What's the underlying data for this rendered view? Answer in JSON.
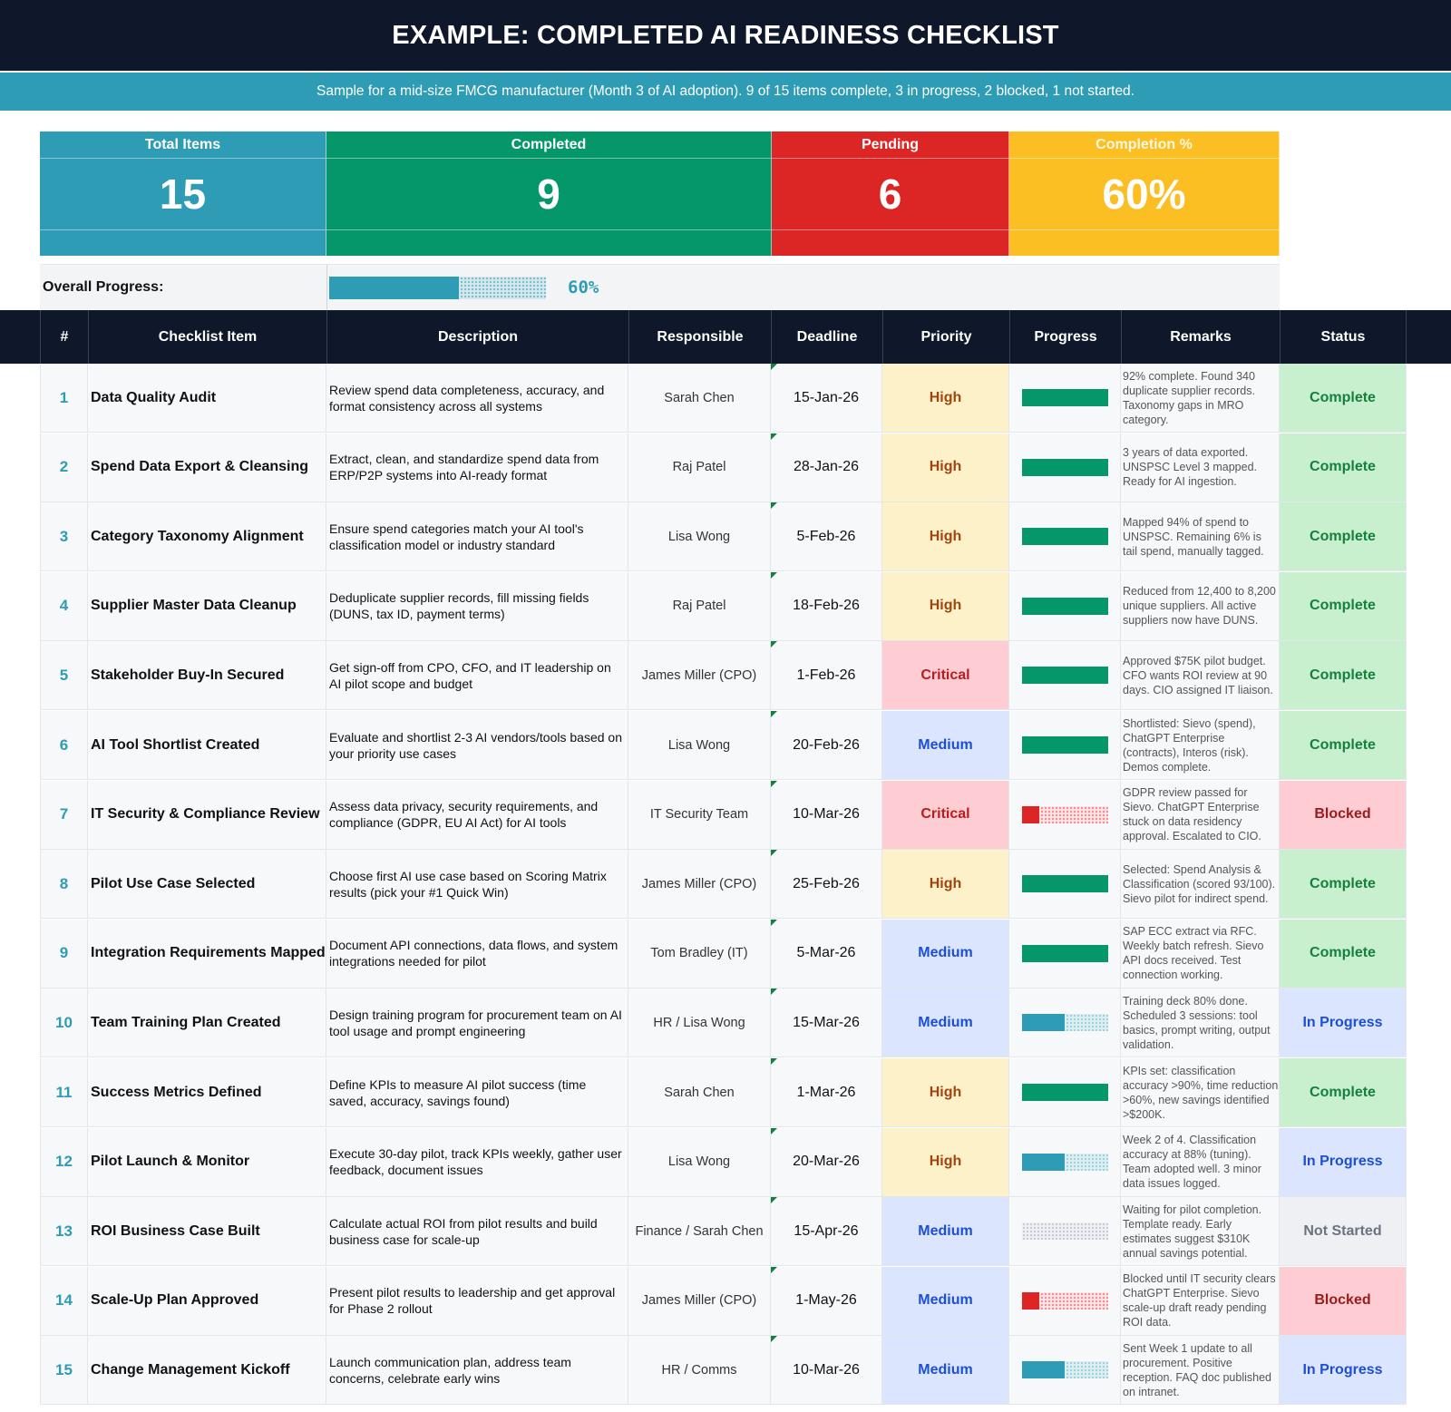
{
  "title": "EXAMPLE: COMPLETED AI READINESS CHECKLIST",
  "subtitle": "Sample for a mid-size FMCG manufacturer (Month 3 of AI adoption). 9 of 15 items complete, 3 in progress, 2 blocked, 1 not started.",
  "kpis": {
    "total": {
      "label": "Total Items",
      "value": "15"
    },
    "completed": {
      "label": "Completed",
      "value": "9"
    },
    "pending": {
      "label": "Pending",
      "value": "6"
    },
    "completion": {
      "label": "Completion %",
      "value": "60%"
    }
  },
  "overall": {
    "label": "Overall Progress:",
    "percent_text": "60%",
    "fraction": 0.6
  },
  "columns": [
    "#",
    "Checklist Item",
    "Description",
    "Responsible",
    "Deadline",
    "Priority",
    "Progress",
    "Remarks",
    "Status"
  ],
  "colors": {
    "navy": "#0f172a",
    "teal": "#2e9cb4",
    "green": "#059669",
    "red": "#dc2626",
    "amber": "#fbbf24",
    "high_bg": "#fdf1c9",
    "high_text": "#a0450f",
    "critical_bg": "#fecdd3",
    "critical_text": "#b91c1c",
    "medium_bg": "#dbe5fd",
    "medium_text": "#1d4ed8",
    "complete_bg": "#c8f0cf",
    "complete_text": "#15803d",
    "blocked_bg": "#fecdd3",
    "blocked_text": "#991b1b",
    "inprogress_bg": "#dbe5fd",
    "inprogress_text": "#1d4ed8",
    "notstarted_bg": "#eef0f3",
    "notstarted_text": "#6b7280"
  },
  "rows": [
    {
      "num": "1",
      "item": "Data Quality Audit",
      "description": "Review spend data completeness, accuracy, and format consistency across all systems",
      "responsible": "Sarah Chen",
      "deadline": "15-Jan-26",
      "priority": "High",
      "progress": 1.0,
      "progress_color": "green",
      "remarks": "92% complete. Found 340 duplicate supplier records. Taxonomy gaps in MRO category.",
      "status": "Complete"
    },
    {
      "num": "2",
      "item": "Spend Data Export & Cleansing",
      "description": "Extract, clean, and standardize spend data from ERP/P2P systems into AI-ready format",
      "responsible": "Raj Patel",
      "deadline": "28-Jan-26",
      "priority": "High",
      "progress": 1.0,
      "progress_color": "green",
      "remarks": "3 years of data exported. UNSPSC Level 3 mapped. Ready for AI ingestion.",
      "status": "Complete"
    },
    {
      "num": "3",
      "item": "Category Taxonomy Alignment",
      "description": "Ensure spend categories match your AI tool's classification model or industry standard",
      "responsible": "Lisa Wong",
      "deadline": "5-Feb-26",
      "priority": "High",
      "progress": 1.0,
      "progress_color": "green",
      "remarks": "Mapped 94% of spend to UNSPSC. Remaining 6% is tail spend, manually tagged.",
      "status": "Complete"
    },
    {
      "num": "4",
      "item": "Supplier Master Data Cleanup",
      "description": "Deduplicate supplier records, fill missing fields (DUNS, tax ID, payment terms)",
      "responsible": "Raj Patel",
      "deadline": "18-Feb-26",
      "priority": "High",
      "progress": 1.0,
      "progress_color": "green",
      "remarks": "Reduced from 12,400 to 8,200 unique suppliers. All active suppliers now have DUNS.",
      "status": "Complete"
    },
    {
      "num": "5",
      "item": "Stakeholder Buy-In Secured",
      "description": "Get sign-off from CPO, CFO, and IT leadership on AI pilot scope and budget",
      "responsible": "James Miller (CPO)",
      "deadline": "1-Feb-26",
      "priority": "Critical",
      "progress": 1.0,
      "progress_color": "green",
      "remarks": "Approved $75K pilot budget. CFO wants ROI review at 90 days. CIO assigned IT liaison.",
      "status": "Complete"
    },
    {
      "num": "6",
      "item": "AI Tool Shortlist Created",
      "description": "Evaluate and shortlist 2-3 AI vendors/tools based on your priority use cases",
      "responsible": "Lisa Wong",
      "deadline": "20-Feb-26",
      "priority": "Medium",
      "progress": 1.0,
      "progress_color": "green",
      "remarks": "Shortlisted: Sievo (spend), ChatGPT Enterprise (contracts), Interos (risk). Demos complete.",
      "status": "Complete"
    },
    {
      "num": "7",
      "item": "IT Security & Compliance Review",
      "description": "Assess data privacy, security requirements, and compliance (GDPR, EU AI Act) for AI tools",
      "responsible": "IT Security Team",
      "deadline": "10-Mar-26",
      "priority": "Critical",
      "progress": 0.2,
      "progress_color": "red",
      "remarks": "GDPR review passed for Sievo. ChatGPT Enterprise stuck on data residency approval. Escalated to CIO.",
      "status": "Blocked"
    },
    {
      "num": "8",
      "item": "Pilot Use Case Selected",
      "description": "Choose first AI use case based on Scoring Matrix results (pick your #1 Quick Win)",
      "responsible": "James Miller (CPO)",
      "deadline": "25-Feb-26",
      "priority": "High",
      "progress": 1.0,
      "progress_color": "green",
      "remarks": "Selected: Spend Analysis & Classification (scored 93/100). Sievo pilot for indirect spend.",
      "status": "Complete"
    },
    {
      "num": "9",
      "item": "Integration Requirements Mapped",
      "description": "Document API connections, data flows, and system integrations needed for pilot",
      "responsible": "Tom Bradley (IT)",
      "deadline": "5-Mar-26",
      "priority": "Medium",
      "progress": 1.0,
      "progress_color": "green",
      "remarks": "SAP ECC extract via RFC. Weekly batch refresh. Sievo API docs received. Test connection working.",
      "status": "Complete"
    },
    {
      "num": "10",
      "item": "Team Training Plan Created",
      "description": "Design training program for procurement team on AI tool usage and prompt engineering",
      "responsible": "HR / Lisa Wong",
      "deadline": "15-Mar-26",
      "priority": "Medium",
      "progress": 0.5,
      "progress_color": "teal",
      "remarks": "Training deck 80% done. Scheduled 3 sessions: tool basics, prompt writing, output validation.",
      "status": "In Progress"
    },
    {
      "num": "11",
      "item": "Success Metrics Defined",
      "description": "Define KPIs to measure AI pilot success (time saved, accuracy, savings found)",
      "responsible": "Sarah Chen",
      "deadline": "1-Mar-26",
      "priority": "High",
      "progress": 1.0,
      "progress_color": "green",
      "remarks": "KPIs set: classification accuracy >90%, time reduction >60%, new savings identified >$200K.",
      "status": "Complete"
    },
    {
      "num": "12",
      "item": "Pilot Launch & Monitor",
      "description": "Execute 30-day pilot, track KPIs weekly, gather user feedback, document issues",
      "responsible": "Lisa Wong",
      "deadline": "20-Mar-26",
      "priority": "High",
      "progress": 0.5,
      "progress_color": "teal",
      "remarks": "Week 2 of 4. Classification accuracy at 88% (tuning). Team adopted well. 3 minor data issues logged.",
      "status": "In Progress"
    },
    {
      "num": "13",
      "item": "ROI Business Case Built",
      "description": "Calculate actual ROI from pilot results and build business case for scale-up",
      "responsible": "Finance / Sarah Chen",
      "deadline": "15-Apr-26",
      "priority": "Medium",
      "progress": 0.0,
      "progress_color": "gray",
      "remarks": "Waiting for pilot completion. Template ready. Early estimates suggest $310K annual savings potential.",
      "status": "Not Started"
    },
    {
      "num": "14",
      "item": "Scale-Up Plan Approved",
      "description": "Present pilot results to leadership and get approval for Phase 2 rollout",
      "responsible": "James Miller (CPO)",
      "deadline": "1-May-26",
      "priority": "Medium",
      "progress": 0.2,
      "progress_color": "red",
      "remarks": "Blocked until IT security clears ChatGPT Enterprise. Sievo scale-up draft ready pending ROI data.",
      "status": "Blocked"
    },
    {
      "num": "15",
      "item": "Change Management Kickoff",
      "description": "Launch communication plan, address team concerns, celebrate early wins",
      "responsible": "HR / Comms",
      "deadline": "10-Mar-26",
      "priority": "Medium",
      "progress": 0.5,
      "progress_color": "teal",
      "remarks": "Sent Week 1 update to all procurement. Positive reception. FAQ doc published on intranet.",
      "status": "In Progress"
    }
  ]
}
